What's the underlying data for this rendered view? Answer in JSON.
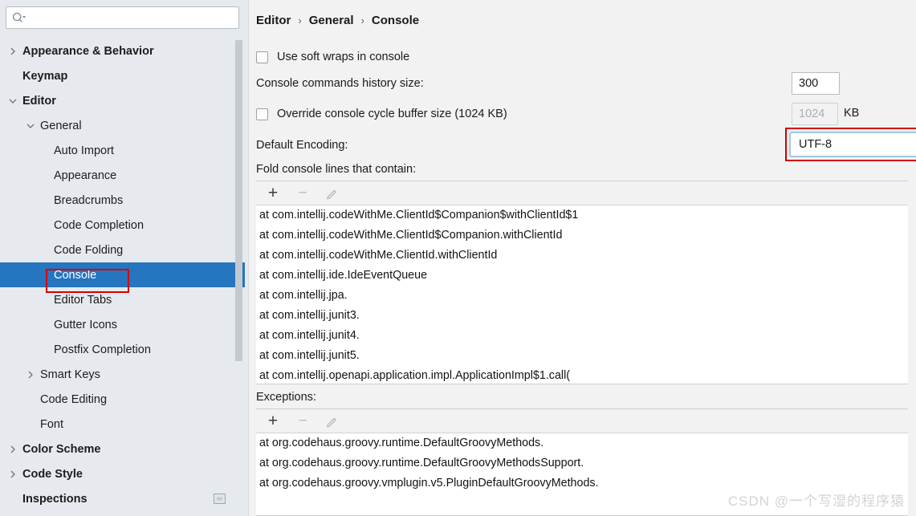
{
  "sidebar": {
    "search": {
      "value": "",
      "placeholder": "",
      "icon": "search-icon"
    },
    "tree": [
      {
        "label": "Appearance & Behavior",
        "level": 0,
        "chevron": "right",
        "bold": true,
        "selected": false
      },
      {
        "label": "Keymap",
        "level": 0,
        "chevron": "none",
        "bold": true,
        "selected": false
      },
      {
        "label": "Editor",
        "level": 0,
        "chevron": "down",
        "bold": true,
        "selected": false
      },
      {
        "label": "General",
        "level": 1,
        "chevron": "down",
        "bold": false,
        "selected": false
      },
      {
        "label": "Auto Import",
        "level": 2,
        "chevron": "none",
        "bold": false,
        "selected": false
      },
      {
        "label": "Appearance",
        "level": 2,
        "chevron": "none",
        "bold": false,
        "selected": false
      },
      {
        "label": "Breadcrumbs",
        "level": 2,
        "chevron": "none",
        "bold": false,
        "selected": false
      },
      {
        "label": "Code Completion",
        "level": 2,
        "chevron": "none",
        "bold": false,
        "selected": false
      },
      {
        "label": "Code Folding",
        "level": 2,
        "chevron": "none",
        "bold": false,
        "selected": false
      },
      {
        "label": "Console",
        "level": 2,
        "chevron": "none",
        "bold": false,
        "selected": true
      },
      {
        "label": "Editor Tabs",
        "level": 2,
        "chevron": "none",
        "bold": false,
        "selected": false
      },
      {
        "label": "Gutter Icons",
        "level": 2,
        "chevron": "none",
        "bold": false,
        "selected": false
      },
      {
        "label": "Postfix Completion",
        "level": 2,
        "chevron": "none",
        "bold": false,
        "selected": false
      },
      {
        "label": "Smart Keys",
        "level": 1,
        "chevron": "right",
        "bold": false,
        "selected": false
      },
      {
        "label": "Code Editing",
        "level": 1,
        "chevron": "none",
        "bold": false,
        "selected": false
      },
      {
        "label": "Font",
        "level": 1,
        "chevron": "none",
        "bold": false,
        "selected": false
      },
      {
        "label": "Color Scheme",
        "level": 0,
        "chevron": "right",
        "bold": false,
        "selected": false
      },
      {
        "label": "Code Style",
        "level": 0,
        "chevron": "right",
        "bold": false,
        "selected": false
      },
      {
        "label": "Inspections",
        "level": 0,
        "chevron": "none",
        "bold": false,
        "selected": false,
        "badge": "config-scope-icon"
      }
    ]
  },
  "main": {
    "breadcrumb": {
      "items": [
        "Editor",
        "General",
        "Console"
      ],
      "separator": "›"
    },
    "soft_wraps": {
      "label": "Use soft wraps in console",
      "checked": false
    },
    "history_size": {
      "label": "Console commands history size:",
      "value": "300"
    },
    "cycle_buffer": {
      "label": "Override console cycle buffer size (1024 KB)",
      "checked": false,
      "value": "1024",
      "unit": "KB",
      "disabled": true
    },
    "default_encoding": {
      "label": "Default Encoding:",
      "value": "UTF-8"
    },
    "fold_console": {
      "label": "Fold console lines that contain:",
      "toolbar": [
        {
          "name": "add-button",
          "glyph": "+",
          "enabled": true
        },
        {
          "name": "remove-button",
          "glyph": "−",
          "enabled": false
        },
        {
          "name": "edit-button",
          "glyph": "pencil",
          "enabled": false
        }
      ],
      "items": [
        "at com.intellij.codeWithMe.ClientId$Companion$withClientId$1",
        "at com.intellij.codeWithMe.ClientId$Companion.withClientId",
        "at com.intellij.codeWithMe.ClientId.withClientId",
        "at com.intellij.ide.IdeEventQueue",
        "at com.intellij.jpa.",
        "at com.intellij.junit3.",
        "at com.intellij.junit4.",
        "at com.intellij.junit5.",
        "at com.intellij.openapi.application.impl.ApplicationImpl$1.call("
      ]
    },
    "exceptions": {
      "label": "Exceptions:",
      "toolbar": [
        {
          "name": "add-button",
          "glyph": "+",
          "enabled": true
        },
        {
          "name": "remove-button",
          "glyph": "−",
          "enabled": false
        },
        {
          "name": "edit-button",
          "glyph": "pencil",
          "enabled": false
        }
      ],
      "items": [
        "at org.codehaus.groovy.runtime.DefaultGroovyMethods.",
        "at org.codehaus.groovy.runtime.DefaultGroovyMethodsSupport.",
        "at org.codehaus.groovy.vmplugin.v5.PluginDefaultGroovyMethods."
      ]
    }
  },
  "watermark": {
    "text": "CSDN @一个写湿的程序猿"
  },
  "colors": {
    "selection_blue": "#2675bf",
    "annotation_red": "#d40000",
    "focus_ring_blue": "#9fc6e8",
    "sidebar_bg": "#e6eaee",
    "panel_bg": "#f2f2f2"
  }
}
